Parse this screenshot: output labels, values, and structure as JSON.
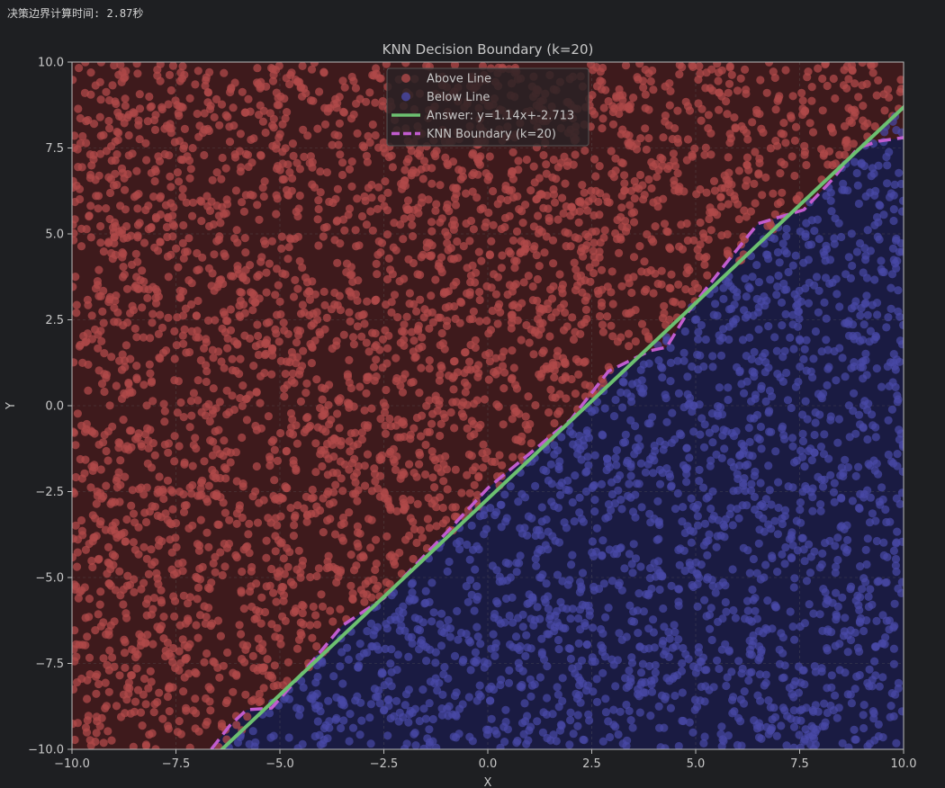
{
  "console": {
    "output_line": "决策边界计算时间: 2.87秒"
  },
  "colors": {
    "page_bg": "#1e1f22",
    "above_region": "#3e1a1c",
    "below_region": "#1a1b42",
    "above_points": "#b04a4a",
    "below_points": "#4848a6",
    "answer_line": "#6cc070",
    "knn_line": "#c15ccf",
    "axis_text": "#c8c8c8",
    "grid": "#6a6a6a"
  },
  "chart_data": {
    "type": "scatter",
    "title": "KNN Decision Boundary (k=20)",
    "xlabel": "X",
    "ylabel": "Y",
    "xlim": [
      -10,
      10
    ],
    "ylim": [
      -10,
      10
    ],
    "x_ticks": [
      "−10.0",
      "−7.5",
      "−5.0",
      "−2.5",
      "0.0",
      "2.5",
      "5.0",
      "7.5",
      "10.0"
    ],
    "y_ticks": [
      "−10.0",
      "−7.5",
      "−5.0",
      "−2.5",
      "0.0",
      "2.5",
      "5.0",
      "7.5",
      "10.0"
    ],
    "grid": true,
    "legend_position": "top-center",
    "legend": [
      {
        "label": "Above Line",
        "kind": "marker",
        "color": "#b04a4a"
      },
      {
        "label": "Below Line",
        "kind": "marker",
        "color": "#4848a6"
      },
      {
        "label": "Answer: y=1.14x+-2.713",
        "kind": "line",
        "color": "#6cc070"
      },
      {
        "label": "KNN Boundary (k=20)",
        "kind": "dashed",
        "color": "#c15ccf"
      }
    ],
    "answer_line": {
      "slope": 1.14,
      "intercept": -2.713
    },
    "knn_boundary": [
      [
        -6.65,
        -10.0
      ],
      [
        -6.2,
        -9.3
      ],
      [
        -5.8,
        -8.85
      ],
      [
        -5.2,
        -8.8
      ],
      [
        -4.4,
        -7.7
      ],
      [
        -3.5,
        -6.4
      ],
      [
        -2.5,
        -5.6
      ],
      [
        -1.0,
        -3.7
      ],
      [
        0.0,
        -2.4
      ],
      [
        1.0,
        -1.4
      ],
      [
        2.0,
        -0.4
      ],
      [
        2.9,
        1.0
      ],
      [
        3.9,
        1.6
      ],
      [
        4.3,
        1.7
      ],
      [
        4.8,
        2.7
      ],
      [
        5.7,
        4.1
      ],
      [
        6.5,
        5.3
      ],
      [
        7.6,
        5.7
      ],
      [
        8.3,
        6.6
      ],
      [
        8.9,
        7.5
      ],
      [
        9.4,
        7.7
      ],
      [
        10.0,
        7.8
      ]
    ],
    "series": [
      {
        "name": "Above Line",
        "rule": "y > 1.14x + -2.713",
        "point_count": 3200
      },
      {
        "name": "Below Line",
        "rule": "y < 1.14x + -2.713",
        "point_count": 2000
      }
    ]
  }
}
